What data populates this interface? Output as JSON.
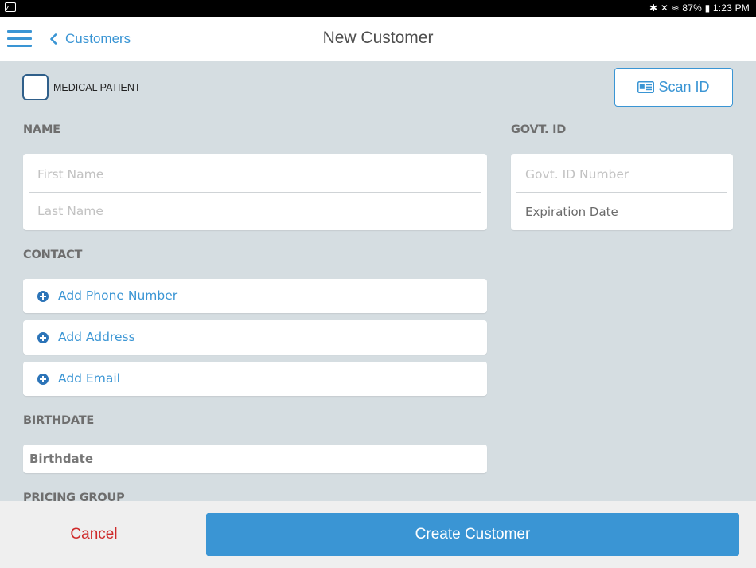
{
  "status_bar": {
    "right_text": "✱ ✕ ≋ 87% ▮ 1:23 PM"
  },
  "header": {
    "back_label": "Customers",
    "title": "New Customer"
  },
  "form": {
    "medical_patient_label": "MEDICAL PATIENT",
    "medical_patient_checked": false,
    "scan_id_label": "Scan ID",
    "name_section": "NAME",
    "first_name_placeholder": "First Name",
    "last_name_placeholder": "Last Name",
    "govt_id_section": "GOVT. ID",
    "govt_id_placeholder": "Govt. ID Number",
    "expiration_date_label": "Expiration Date",
    "contact_section": "CONTACT",
    "add_phone_label": "Add Phone Number",
    "add_address_label": "Add Address",
    "add_email_label": "Add Email",
    "birthdate_section": "BIRTHDATE",
    "birthdate_label": "Birthdate",
    "pricing_group_section": "PRICING GROUP"
  },
  "footer": {
    "cancel_label": "Cancel",
    "create_label": "Create Customer"
  },
  "colors": {
    "accent": "#3a95d4",
    "cancel": "#cf2a2a",
    "background": "#d5dde1"
  }
}
